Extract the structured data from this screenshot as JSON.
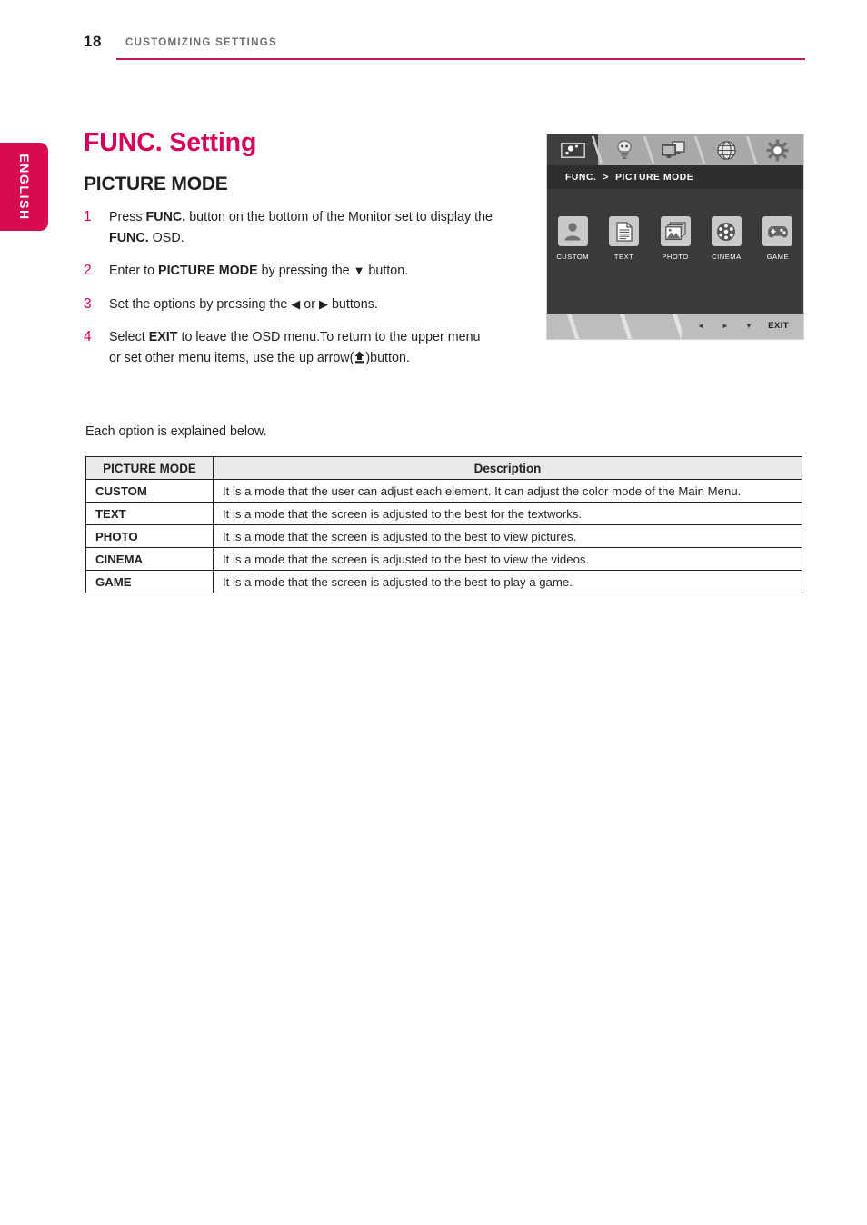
{
  "header": {
    "page_number": "18",
    "title": "CUSTOMIZING SETTINGS",
    "rule_color": "#c3165c"
  },
  "language_tab": {
    "label": "ENGLISH",
    "color": "#d60b52"
  },
  "titles": {
    "func_title": "FUNC. Setting",
    "func_title_color": "#d6005a",
    "section_title": "PICTURE MODE"
  },
  "steps": [
    {
      "number": "1",
      "parts": [
        {
          "t": "Press ",
          "b": false
        },
        {
          "t": "FUNC.",
          "b": true
        },
        {
          "t": " button on   the bottom of the Monitor set to display the ",
          "b": false
        },
        {
          "t": "FUNC.",
          "b": true
        },
        {
          "t": " OSD.",
          "b": false
        }
      ]
    },
    {
      "number": "2",
      "parts": [
        {
          "t": "Enter to ",
          "b": false
        },
        {
          "t": "PICTURE MODE",
          "b": true
        },
        {
          "t": " by pressing the ",
          "b": false
        },
        {
          "t": "▼",
          "b": false
        },
        {
          "t": " button.",
          "b": false
        }
      ]
    },
    {
      "number": "3",
      "parts": [
        {
          "t": "Set the options by pressing the ",
          "b": false
        },
        {
          "t": "◀",
          "b": false
        },
        {
          "t": " or ",
          "b": false
        },
        {
          "t": "▶",
          "b": false
        },
        {
          "t": " buttons.",
          "b": false
        }
      ]
    },
    {
      "number": "4",
      "parts": [
        {
          "t": "Select ",
          "b": false
        },
        {
          "t": "EXIT",
          "b": true
        },
        {
          "t": " to leave the OSD menu.To return to the upper menu or set other menu items, use  the up arrow(",
          "b": false
        },
        {
          "t": "UP_ARROW_ICON",
          "b": false
        },
        {
          "t": ")button.",
          "b": false
        }
      ]
    }
  ],
  "table_intro": "Each option is explained below.",
  "table": {
    "headers": [
      "PICTURE MODE",
      "Description"
    ],
    "rows": [
      {
        "mode": "CUSTOM",
        "description": "It is a mode that the user can adjust each element. It can adjust the color mode of the Main Menu."
      },
      {
        "mode": "TEXT",
        "description": "It is a mode that the screen is adjusted to the best for the textworks."
      },
      {
        "mode": "PHOTO",
        "description": "It is a mode that the screen is adjusted to the best to view pictures."
      },
      {
        "mode": "CINEMA",
        "description": "It is a mode that the screen is adjusted to the best to view the videos."
      },
      {
        "mode": "GAME",
        "description": "It is a mode that the screen is adjusted to the best to play a game."
      }
    ]
  },
  "osd": {
    "tabs": [
      {
        "icon": "picture-icon",
        "active": true
      },
      {
        "icon": "lightbulb-icon",
        "active": false
      },
      {
        "icon": "dual-monitor-icon",
        "active": false
      },
      {
        "icon": "globe-icon",
        "active": false
      },
      {
        "icon": "gear-icon",
        "active": false
      }
    ],
    "breadcrumb": {
      "root": "FUNC.",
      "separator": ">",
      "current": "PICTURE MODE"
    },
    "modes": [
      {
        "label": "CUSTOM",
        "icon": "person-icon"
      },
      {
        "label": "TEXT",
        "icon": "document-icon"
      },
      {
        "label": "PHOTO",
        "icon": "photos-icon"
      },
      {
        "label": "CINEMA",
        "icon": "film-reel-icon"
      },
      {
        "label": "GAME",
        "icon": "gamepad-icon"
      }
    ],
    "footer": {
      "left_arrow": "◄",
      "right_arrow": "►",
      "down_arrow": "▼",
      "exit_label": "EXIT"
    }
  }
}
